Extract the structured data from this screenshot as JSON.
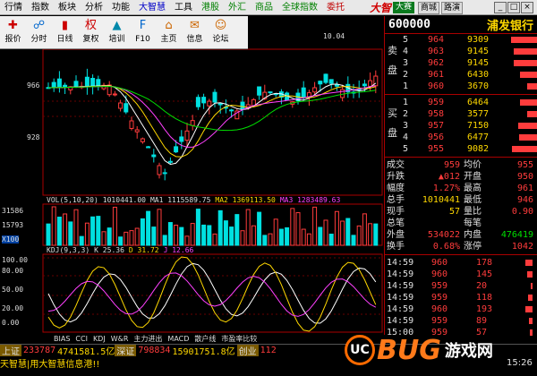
{
  "menu": {
    "items": [
      {
        "label": "行情",
        "style": ""
      },
      {
        "label": "指数",
        "style": ""
      },
      {
        "label": "板块",
        "style": ""
      },
      {
        "label": "分析",
        "style": ""
      },
      {
        "label": "功能",
        "style": ""
      },
      {
        "label": "大智慧",
        "style": "blue"
      },
      {
        "label": "工具",
        "style": ""
      },
      {
        "label": "港股",
        "style": "green"
      },
      {
        "label": "外汇",
        "style": "green"
      },
      {
        "label": "商品",
        "style": "green"
      },
      {
        "label": "全球指数",
        "style": "green"
      },
      {
        "label": "委托",
        "style": "red"
      }
    ],
    "brand": "大智",
    "brand_tag": "大赛",
    "btn1": "商城",
    "btn2": "路演",
    "win": [
      "_",
      "□",
      "×"
    ]
  },
  "toolbar": [
    {
      "label": "报价",
      "icon": "✚",
      "color": "#c00"
    },
    {
      "label": "分时",
      "icon": "☍",
      "color": "#06c"
    },
    {
      "label": "日线",
      "icon": "▮",
      "color": "#c00"
    },
    {
      "label": "复权",
      "icon": "权",
      "color": "#c00"
    },
    {
      "label": "培训",
      "icon": "▲",
      "color": "#08a"
    },
    {
      "label": "F10",
      "icon": "F",
      "color": "#06c"
    },
    {
      "label": "主页",
      "icon": "⌂",
      "color": "#c60"
    },
    {
      "label": "信息",
      "icon": "✉",
      "color": "#c60"
    },
    {
      "label": "论坛",
      "icon": "☺",
      "color": "#c60"
    }
  ],
  "price_axis": {
    "p966": "966",
    "p928": "928",
    "high_label": "10.04"
  },
  "vol_axis": {
    "v1": "31586",
    "v2": "15793",
    "v3": "X100"
  },
  "kdj_axis": {
    "k1": "100.00",
    "k2": "80.00",
    "k3": "50.00",
    "k4": "20.00",
    "k5": "0.00"
  },
  "vol_legend": {
    "head": "VOL(5,10,20)",
    "v0": "1010441.00",
    "ma1": "MA1 1115589.75",
    "ma2": "MA2 1369113.50",
    "ma3": "MA3 1283489.63"
  },
  "kdj_legend": {
    "head": "KDJ(9,3,3)",
    "k": "K 25.36",
    "d": "D 31.72",
    "j": "J 12.66"
  },
  "tabs": [
    "BIAS",
    "CCI",
    "KDJ",
    "W&R",
    "主力进出",
    "MACD",
    "散户线",
    "市盈率比较"
  ],
  "stock": {
    "code": "600000",
    "name": "浦发银行"
  },
  "asks": [
    {
      "lv": "5",
      "p": "964",
      "v": "9309",
      "bar": 60
    },
    {
      "lv": "4",
      "p": "963",
      "v": "9145",
      "bar": 55
    },
    {
      "lv": "3",
      "p": "962",
      "v": "9145",
      "bar": 55
    },
    {
      "lv": "2",
      "p": "961",
      "v": "6430",
      "bar": 40
    },
    {
      "lv": "1",
      "p": "960",
      "v": "3670",
      "bar": 25
    }
  ],
  "ask_side": "卖 盘",
  "bids": [
    {
      "lv": "1",
      "p": "959",
      "v": "6464",
      "bar": 40
    },
    {
      "lv": "2",
      "p": "958",
      "v": "3577",
      "bar": 25
    },
    {
      "lv": "3",
      "p": "957",
      "v": "7150",
      "bar": 45
    },
    {
      "lv": "4",
      "p": "956",
      "v": "6477",
      "bar": 42
    },
    {
      "lv": "5",
      "p": "955",
      "v": "9082",
      "bar": 58
    }
  ],
  "bid_side": "买 盘",
  "stats": [
    {
      "a": "成交",
      "b": "959",
      "c": "均价",
      "d": "955"
    },
    {
      "a": "升跌",
      "b": "▲012",
      "c": "开盘",
      "d": "950"
    },
    {
      "a": "幅度",
      "b": "1.27%",
      "c": "最高",
      "d": "961"
    },
    {
      "a": "总手",
      "b": "1010441",
      "c": "最低",
      "d": "946"
    },
    {
      "a": "现手",
      "b": "57",
      "c": "量比",
      "d": "0.90"
    },
    {
      "a": "总笔",
      "b": "",
      "c": "每笔",
      "d": ""
    },
    {
      "a": "外盘",
      "b": "534022",
      "c": "内盘",
      "d": "476419"
    },
    {
      "a": "换手",
      "b": "0.68%",
      "c": "涨停",
      "d": "1042"
    }
  ],
  "ticks": [
    {
      "t": "14:59",
      "p": "960",
      "v": "178",
      "bar": 8
    },
    {
      "t": "14:59",
      "p": "960",
      "v": "145",
      "bar": 6
    },
    {
      "t": "14:59",
      "p": "959",
      "v": "20",
      "bar": 2
    },
    {
      "t": "14:59",
      "p": "959",
      "v": "118",
      "bar": 5
    },
    {
      "t": "14:59",
      "p": "960",
      "v": "193",
      "bar": 8
    },
    {
      "t": "14:59",
      "p": "959",
      "v": "89",
      "bar": 4
    },
    {
      "t": "15:00",
      "p": "959",
      "v": "57",
      "bar": 3
    }
  ],
  "status": {
    "sh_label": "上证",
    "sh_val": "233787",
    "sh_idx": "4741581.5亿",
    "sz_label": "深证",
    "sz_val": "798834",
    "sz_idx": "15901751.8亿",
    "cy_label": "创业",
    "cy_val": "112"
  },
  "marquee": "天智慧|用大智慧信息港!!",
  "clock": "15:26",
  "watermark": {
    "logo": "UC",
    "text": "BUG",
    "cn": "游戏网"
  }
}
